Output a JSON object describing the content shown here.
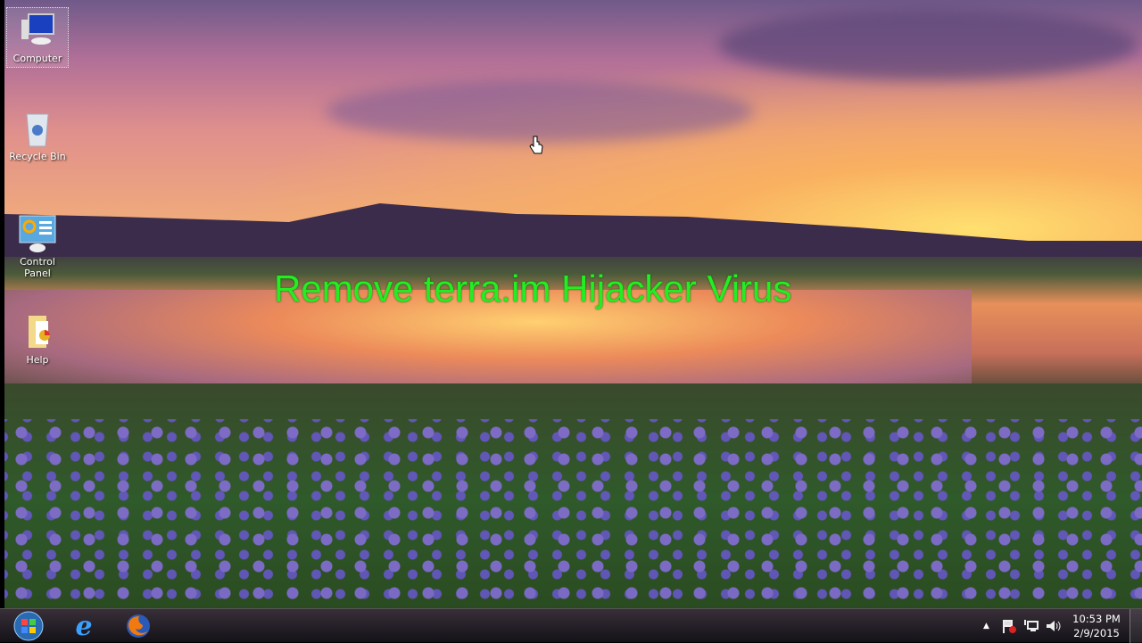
{
  "desktop_icons": [
    {
      "label": "Computer"
    },
    {
      "label": "Recycle Bin"
    },
    {
      "label": "Control Panel"
    },
    {
      "label": "Help"
    }
  ],
  "overlay_title": "Remove terra.im Hijacker Virus",
  "taskbar": {
    "pinned": [
      {
        "name": "start-button"
      },
      {
        "name": "internet-explorer"
      },
      {
        "name": "firefox"
      }
    ],
    "tray": {
      "time": "10:53 PM",
      "date": "2/9/2015"
    }
  }
}
